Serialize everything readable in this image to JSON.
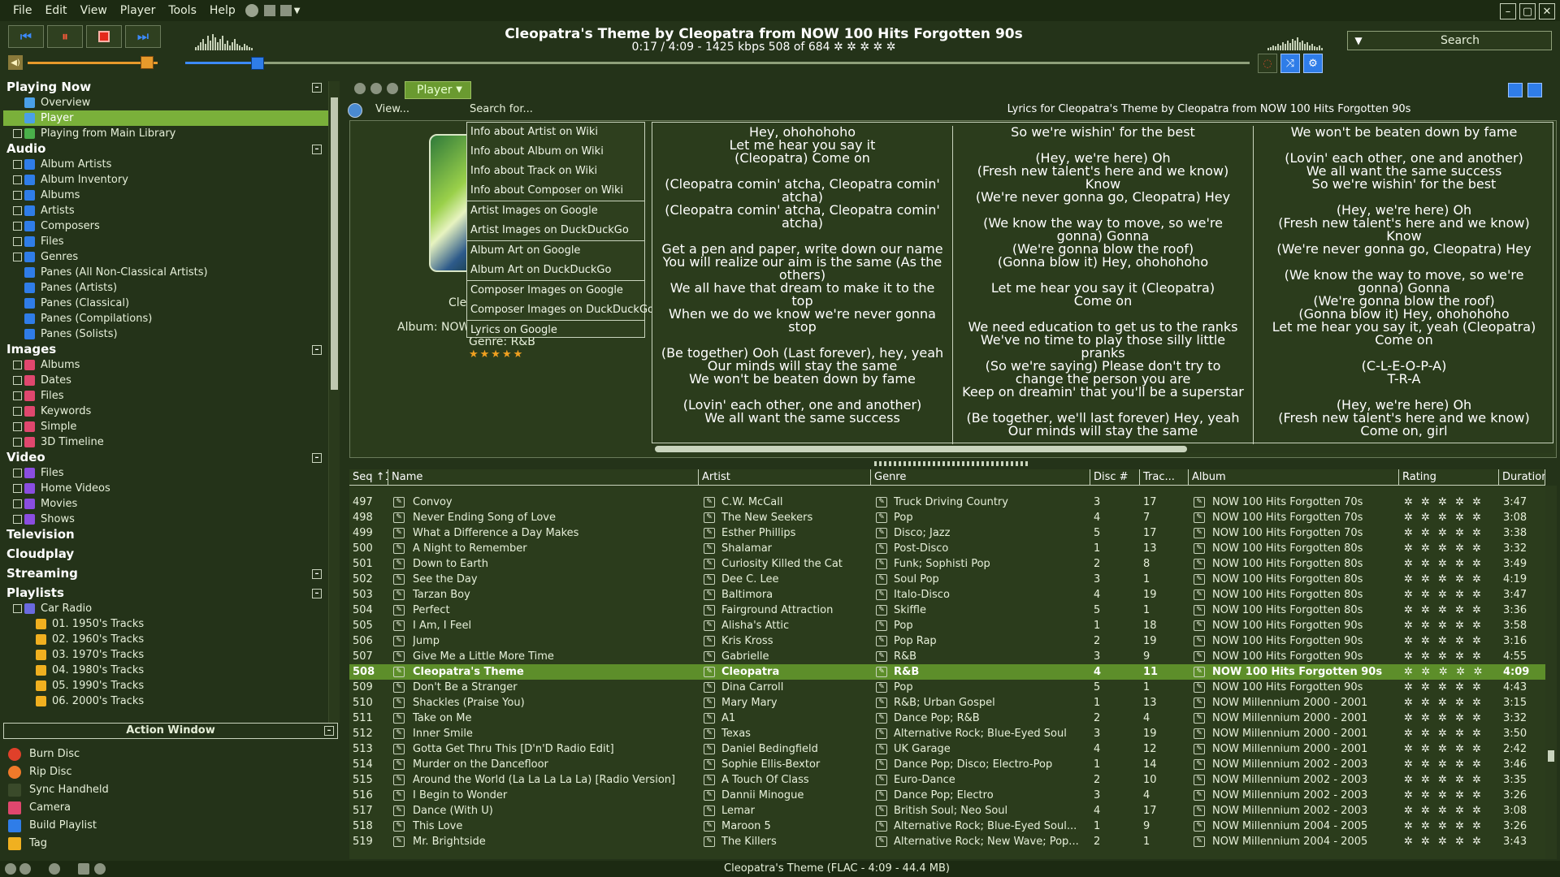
{
  "menu": [
    "File",
    "Edit",
    "View",
    "Player",
    "Tools",
    "Help"
  ],
  "now_playing": {
    "title": "Cleopatra's Theme by Cleopatra from NOW 100 Hits Forgotten 90s",
    "info": "0:17 / 4:09 - 1425 kbps  508 of 684 ✲ ✲ ✲ ✲ ✲",
    "volume_fraction": 0.92,
    "seek_fraction": 0.068
  },
  "search": {
    "label": "Search"
  },
  "tree": {
    "playing_now": {
      "label": "Playing Now",
      "items": [
        "Overview",
        "Player",
        "Playing from Main Library"
      ]
    },
    "audio": {
      "label": "Audio",
      "items": [
        "Album Artists",
        "Album Inventory",
        "Albums",
        "Artists",
        "Composers",
        "Files",
        "Genres",
        "Panes (All Non-Classical Artists)",
        "Panes (Artists)",
        "Panes (Classical)",
        "Panes (Compilations)",
        "Panes (Solists)"
      ]
    },
    "images": {
      "label": "Images",
      "items": [
        "Albums",
        "Dates",
        "Files",
        "Keywords",
        "Simple",
        "3D Timeline"
      ]
    },
    "video": {
      "label": "Video",
      "items": [
        "Files",
        "Home Videos",
        "Movies",
        "Shows"
      ]
    },
    "television": "Television",
    "cloudplay": "Cloudplay",
    "streaming": "Streaming",
    "playlists": {
      "label": "Playlists",
      "items": [
        "Car Radio",
        "01. 1950's Tracks",
        "02. 1960's Tracks",
        "03. 1970's Tracks",
        "04. 1980's Tracks",
        "05. 1990's Tracks",
        "06. 2000's Tracks"
      ]
    }
  },
  "action_window": {
    "title": "Action Window",
    "items": [
      "Burn Disc",
      "Rip Disc",
      "Sync Handheld",
      "Camera",
      "Build Playlist",
      "Tag"
    ]
  },
  "player_tab": "Player",
  "subbar": {
    "view": "View...",
    "search_for": "Search for...",
    "lyrics_title": "Lyrics for Cleopatra's Theme by Cleopatra from NOW 100 Hits Forgotten 90s"
  },
  "art": {
    "artist": "Cle",
    "album": "Album: NOW",
    "genre": "Genre: R&B",
    "stars": "★★★★★"
  },
  "context_menu": [
    "Info about Artist on Wiki",
    "Info about Album on Wiki",
    "Info about Track on Wiki",
    "Info about Composer on Wiki",
    "Artist Images on Google",
    "Artist Images on DuckDuckGo",
    "Album Art on Google",
    "Album Art on DuckDuckGo",
    "Composer Images on Google",
    "Composer Images on DuckDuckGo",
    "Lyrics on Google"
  ],
  "lyrics": {
    "col1": "Hey, ohohohoho\nLet me hear you say it\n(Cleopatra) Come on\n\n(Cleopatra comin' atcha, Cleopatra comin' atcha)\n(Cleopatra comin' atcha, Cleopatra comin' atcha)\n\nGet a pen and paper, write down our name\nYou will realize our aim is the same (As the others)\nWe all have that dream to make it to the top\nWhen we do we know we're never gonna stop\n\n(Be together) Ooh (Last forever), hey, yeah\nOur minds will stay the same\nWe won't be beaten down by fame\n\n(Lovin' each other, one and another)\nWe all want the same success",
    "col2": "So we're wishin' for the best\n\n(Hey, we're here) Oh\n(Fresh new talent's here and we know) Know\n(We're never gonna go, Cleopatra) Hey\n\n(We know the way to move, so we're gonna) Gonna\n(We're gonna blow the roof)\n(Gonna blow it) Hey, ohohohoho\n\nLet me hear you say it (Cleopatra)\nCome on\n\nWe need education to get us to the ranks\nWe've no time to play those silly little pranks\n(So we're saying) Please don't try to change the person you are\nKeep on dreamin' that you'll be a superstar\n\n(Be together, we'll last forever) Hey, yeah\nOur minds will stay the same",
    "col3": "We won't be beaten down by fame\n\n(Lovin' each other, one and another)\nWe all want the same success\nSo we're wishin' for the best\n\n(Hey, we're here) Oh\n(Fresh new talent's here and we know) Know\n(We're never gonna go, Cleopatra) Hey\n\n(We know the way to move, so we're gonna) Gonna\n(We're gonna blow the roof)\n(Gonna blow it) Hey, ohohohoho\nLet me hear you say it, yeah (Cleopatra)\nCome on\n\n(C-L-E-O-P-A)\nT-R-A\n\n(Hey, we're here) Oh\n(Fresh new talent's here and we know)\nCome on, girl"
  },
  "columns": [
    "Seq ↑1",
    "Name",
    "Artist",
    "Genre",
    "Disc #",
    "Trac...",
    "Album",
    "Rating",
    "Duration"
  ],
  "rows": [
    [
      "497",
      "Convoy",
      "C.W. McCall",
      "Truck Driving Country",
      "3",
      "17",
      "NOW 100 Hits Forgotten 70s",
      "3:47"
    ],
    [
      "498",
      "Never Ending Song of Love",
      "The New Seekers",
      "Pop",
      "4",
      "7",
      "NOW 100 Hits Forgotten 70s",
      "3:08"
    ],
    [
      "499",
      "What a Difference a Day Makes",
      "Esther Phillips",
      "Disco; Jazz",
      "5",
      "17",
      "NOW 100 Hits Forgotten 70s",
      "3:38"
    ],
    [
      "500",
      "A Night to Remember",
      "Shalamar",
      "Post-Disco",
      "1",
      "13",
      "NOW 100 Hits Forgotten 80s",
      "3:32"
    ],
    [
      "501",
      "Down to Earth",
      "Curiosity Killed the Cat",
      "Funk; Sophisti Pop",
      "2",
      "8",
      "NOW 100 Hits Forgotten 80s",
      "3:49"
    ],
    [
      "502",
      "See the Day",
      "Dee C. Lee",
      "Soul Pop",
      "3",
      "1",
      "NOW 100 Hits Forgotten 80s",
      "4:19"
    ],
    [
      "503",
      "Tarzan Boy",
      "Baltimora",
      "Italo-Disco",
      "4",
      "19",
      "NOW 100 Hits Forgotten 80s",
      "3:47"
    ],
    [
      "504",
      "Perfect",
      "Fairground Attraction",
      "Skiffle",
      "5",
      "1",
      "NOW 100 Hits Forgotten 80s",
      "3:36"
    ],
    [
      "505",
      "I Am, I Feel",
      "Alisha's Attic",
      "Pop",
      "1",
      "18",
      "NOW 100 Hits Forgotten 90s",
      "3:58"
    ],
    [
      "506",
      "Jump",
      "Kris Kross",
      "Pop Rap",
      "2",
      "19",
      "NOW 100 Hits Forgotten 90s",
      "3:16"
    ],
    [
      "507",
      "Give Me a Little More Time",
      "Gabrielle",
      "R&B",
      "3",
      "9",
      "NOW 100 Hits Forgotten 90s",
      "4:55"
    ],
    [
      "508",
      "Cleopatra's Theme",
      "Cleopatra",
      "R&B",
      "4",
      "11",
      "NOW 100 Hits Forgotten 90s",
      "4:09"
    ],
    [
      "509",
      "Don't Be a Stranger",
      "Dina Carroll",
      "Pop",
      "5",
      "1",
      "NOW 100 Hits Forgotten 90s",
      "4:43"
    ],
    [
      "510",
      "Shackles (Praise You)",
      "Mary Mary",
      "R&B; Urban Gospel",
      "1",
      "13",
      "NOW Millennium 2000 - 2001",
      "3:15"
    ],
    [
      "511",
      "Take on Me",
      "A1",
      "Dance Pop; R&B",
      "2",
      "4",
      "NOW Millennium 2000 - 2001",
      "3:32"
    ],
    [
      "512",
      "Inner Smile",
      "Texas",
      "Alternative Rock; Blue-Eyed Soul",
      "3",
      "19",
      "NOW Millennium 2000 - 2001",
      "3:50"
    ],
    [
      "513",
      "Gotta Get Thru This [D'n'D Radio Edit]",
      "Daniel Bedingfield",
      "UK Garage",
      "4",
      "12",
      "NOW Millennium 2000 - 2001",
      "2:42"
    ],
    [
      "514",
      "Murder on the Dancefloor",
      "Sophie Ellis-Bextor",
      "Dance Pop; Disco; Electro-Pop",
      "1",
      "14",
      "NOW Millennium 2002 - 2003",
      "3:46"
    ],
    [
      "515",
      "Around the World (La La La La La) [Radio Version]",
      "A Touch Of Class",
      "Euro-Dance",
      "2",
      "10",
      "NOW Millennium 2002 - 2003",
      "3:35"
    ],
    [
      "516",
      "I Begin to Wonder",
      "Dannii Minogue",
      "Dance Pop; Electro",
      "3",
      "4",
      "NOW Millennium 2002 - 2003",
      "3:26"
    ],
    [
      "517",
      "Dance (With U)",
      "Lemar",
      "British Soul; Neo Soul",
      "4",
      "17",
      "NOW Millennium 2002 - 2003",
      "3:08"
    ],
    [
      "518",
      "This Love",
      "Maroon 5",
      "Alternative Rock; Blue-Eyed Soul...",
      "1",
      "9",
      "NOW Millennium 2004 - 2005",
      "3:26"
    ],
    [
      "519",
      "Mr. Brightside",
      "The Killers",
      "Alternative Rock; New Wave; Pop...",
      "2",
      "1",
      "NOW Millennium 2004 - 2005",
      "3:43"
    ]
  ],
  "rating_stars": "✲ ✲ ✲ ✲ ✲",
  "status": "Cleopatra's Theme (FLAC - 4:09 - 44.4 MB)",
  "colors": {
    "accent_green": "#7ab03a",
    "selected_row": "#5d8e2a",
    "blue": "#2f7de8",
    "orange": "#e79a2b"
  }
}
